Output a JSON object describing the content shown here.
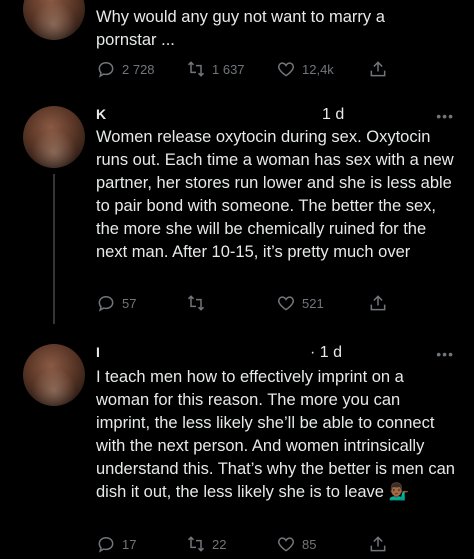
{
  "tweet1": {
    "text": "Why would any guy not want to marry a pornstar ...",
    "replies": "2 728",
    "retweets": "1 637",
    "likes": "12,4k"
  },
  "tweet2": {
    "name": "K",
    "handle_fragment": "·",
    "time": "1 d",
    "text": "Women release oxytocin during sex. Oxytocin runs out. Each time a woman has sex with a new partner, her stores run lower and she is less able to pair bond with someone. The better the sex, the more she will be chemically ruined for the next man. After 10-15, it’s pretty much over",
    "replies": "57",
    "retweets": "",
    "likes": "521"
  },
  "tweet3": {
    "name": "I",
    "time": "· 1 d",
    "text": "I teach men how to effectively imprint on a woman for this reason. The more you can imprint, the less likely she’ll be able to connect with the next person. And women intrinsically understand this. That’s why the better is men can dish it out, the less likely she is to leave 💁🏾‍♂️",
    "replies": "17",
    "retweets": "22",
    "likes": "85"
  },
  "more_label": "•••",
  "icons": [
    "reply-icon",
    "retweet-icon",
    "like-icon",
    "share-icon"
  ]
}
